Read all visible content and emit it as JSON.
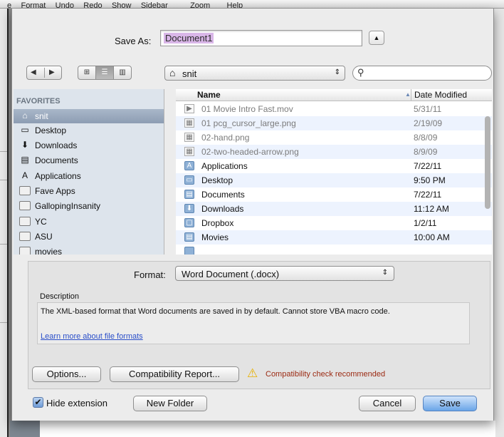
{
  "menubar": [
    "e",
    "Format",
    "Undo",
    "Redo",
    "Show",
    "Sidebar",
    "Zoom",
    "Help"
  ],
  "save_as": {
    "label": "Save As:",
    "value": "Document1",
    "expand_icon": "triangle-up-icon"
  },
  "toolbar": {
    "back_icon": "◀",
    "forward_icon": "▶",
    "view_icon_glyph": "⊞",
    "view_list_glyph": "☰",
    "view_column_glyph": "▥",
    "location": "snit",
    "location_icon": "⌂",
    "location_arrows": "⇕",
    "search_placeholder": "",
    "search_icon": "⚲"
  },
  "sidebar": {
    "heading": "FAVORITES",
    "items": [
      {
        "label": "snit",
        "icon": "⌂",
        "selected": true
      },
      {
        "label": "Desktop",
        "icon": "▭"
      },
      {
        "label": "Downloads",
        "icon": "⬇"
      },
      {
        "label": "Documents",
        "icon": "▤"
      },
      {
        "label": "Applications",
        "icon": "A"
      },
      {
        "label": "Fave Apps",
        "icon": ""
      },
      {
        "label": "GallopingInsanity",
        "icon": ""
      },
      {
        "label": "YC",
        "icon": ""
      },
      {
        "label": "ASU",
        "icon": ""
      },
      {
        "label": "movies",
        "icon": ""
      }
    ]
  },
  "filelist": {
    "columns": {
      "name": "Name",
      "date": "Date Modified",
      "sort_arrow": "▲"
    },
    "rows": [
      {
        "name": "01 Movie Intro Fast.mov",
        "date": "5/31/11",
        "type": "file",
        "dim": true,
        "glyph": "▶"
      },
      {
        "name": "01 pcg_cursor_large.png",
        "date": "2/19/09",
        "type": "file",
        "dim": true,
        "glyph": "▦"
      },
      {
        "name": "02-hand.png",
        "date": "8/8/09",
        "type": "file",
        "dim": true,
        "glyph": "▦"
      },
      {
        "name": "02-two-headed-arrow.png",
        "date": "8/9/09",
        "type": "file",
        "dim": true,
        "glyph": "▦"
      },
      {
        "name": "Applications",
        "date": "7/22/11",
        "type": "folder",
        "glyph": "A"
      },
      {
        "name": "Desktop",
        "date": "9:50 PM",
        "type": "folder",
        "glyph": "▭"
      },
      {
        "name": "Documents",
        "date": "7/22/11",
        "type": "folder",
        "glyph": "▤"
      },
      {
        "name": "Downloads",
        "date": "11:12 AM",
        "type": "folder",
        "glyph": "⬇"
      },
      {
        "name": "Dropbox",
        "date": "1/2/11",
        "type": "folder",
        "glyph": "▢"
      },
      {
        "name": "Movies",
        "date": "10:00 AM",
        "type": "folder",
        "glyph": "▤"
      },
      {
        "name": "",
        "date": "",
        "type": "folder",
        "glyph": ""
      }
    ]
  },
  "accessory": {
    "format_label": "Format:",
    "format_value": "Word Document (.docx)",
    "format_arrows": "⇕",
    "description_label": "Description",
    "description_text": "The XML-based format that Word documents are saved in by default. Cannot store VBA macro code.",
    "learn_more": "Learn more about file formats"
  },
  "buttons": {
    "options": "Options...",
    "compatibility": "Compatibility Report...",
    "warning_icon": "⚠",
    "warning_text": "Compatibility check recommended",
    "hide_extension": "Hide extension",
    "hide_extension_checked": true,
    "check_glyph": "✔",
    "new_folder": "New Folder",
    "cancel": "Cancel",
    "save": "Save"
  },
  "colors": {
    "selection_highlight": "#d9b6e8",
    "default_button": "#6aa5e8",
    "warning_text": "#9b2a12",
    "link": "#2b4fc9"
  }
}
